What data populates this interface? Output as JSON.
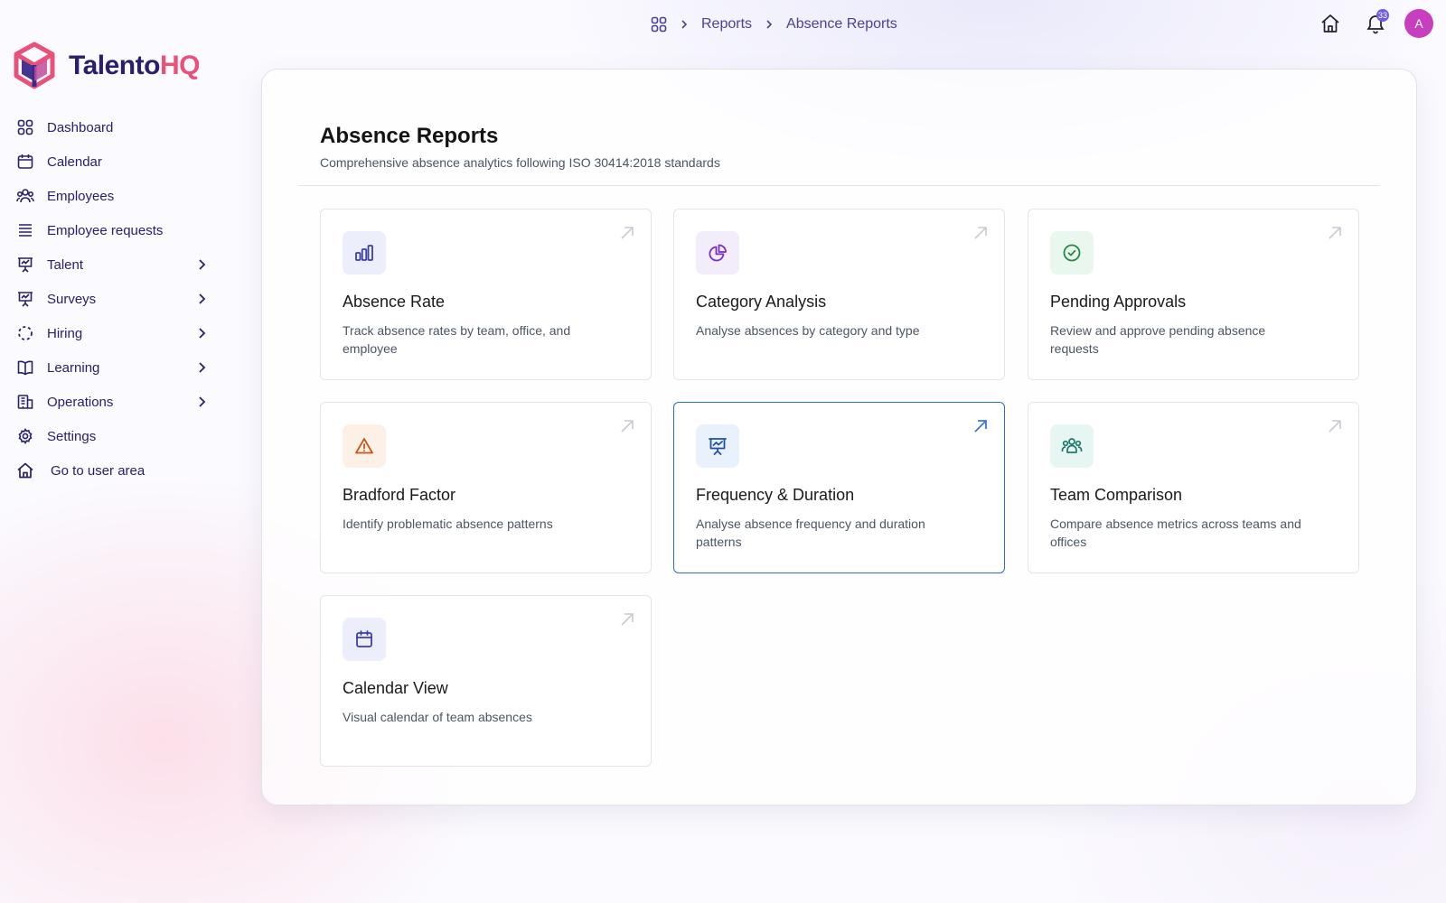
{
  "brand": {
    "name_part1": "Talento",
    "name_part2": "HQ"
  },
  "sidebar": {
    "items": [
      {
        "label": "Dashboard",
        "icon": "dashboard-grid-icon",
        "has_submenu": false
      },
      {
        "label": "Calendar",
        "icon": "calendar-icon",
        "has_submenu": false
      },
      {
        "label": "Employees",
        "icon": "users-icon",
        "has_submenu": false
      },
      {
        "label": "Employee requests",
        "icon": "list-icon",
        "has_submenu": false
      },
      {
        "label": "Talent",
        "icon": "presentation-chart-icon",
        "has_submenu": true
      },
      {
        "label": "Surveys",
        "icon": "presentation-chart-icon",
        "has_submenu": true
      },
      {
        "label": "Hiring",
        "icon": "dashed-circle-icon",
        "has_submenu": true
      },
      {
        "label": "Learning",
        "icon": "book-icon",
        "has_submenu": true
      },
      {
        "label": "Operations",
        "icon": "building-icon",
        "has_submenu": true
      },
      {
        "label": "Settings",
        "icon": "gear-icon",
        "has_submenu": false
      },
      {
        "label": "Go to user area",
        "icon": "home-icon",
        "has_submenu": false
      }
    ]
  },
  "breadcrumb": {
    "level1": "Reports",
    "level2": "Absence Reports"
  },
  "topbar": {
    "notification_count": "33",
    "avatar_initial": "A"
  },
  "page": {
    "title": "Absence Reports",
    "subtitle": "Comprehensive absence analytics following ISO 30414:2018 standards"
  },
  "cards": [
    {
      "title": "Absence Rate",
      "description": "Track absence rates by team, office, and employee",
      "icon": "bar-chart-icon",
      "tile_color": "#eceefc",
      "icon_color": "#3b3fa8"
    },
    {
      "title": "Category Analysis",
      "description": "Analyse absences by category and type",
      "icon": "pie-chart-icon",
      "tile_color": "#f3ecfb",
      "icon_color": "#7b2fbe"
    },
    {
      "title": "Pending Approvals",
      "description": "Review and approve pending absence requests",
      "icon": "check-circle-icon",
      "tile_color": "#eaf7ee",
      "icon_color": "#1f8a43"
    },
    {
      "title": "Bradford Factor",
      "description": "Identify problematic absence patterns",
      "icon": "warning-triangle-icon",
      "tile_color": "#fdf0e6",
      "icon_color": "#c4561a"
    },
    {
      "title": "Frequency & Duration",
      "description": "Analyse absence frequency and duration patterns",
      "icon": "presentation-chart-icon",
      "tile_color": "#e9f1fc",
      "icon_color": "#1f4fa8"
    },
    {
      "title": "Team Comparison",
      "description": "Compare absence metrics across teams and offices",
      "icon": "team-icon",
      "tile_color": "#e7f6f3",
      "icon_color": "#1c7a6d"
    },
    {
      "title": "Calendar View",
      "description": "Visual calendar of team absences",
      "icon": "calendar-icon",
      "tile_color": "#eceefc",
      "icon_color": "#3b3fa8"
    }
  ]
}
